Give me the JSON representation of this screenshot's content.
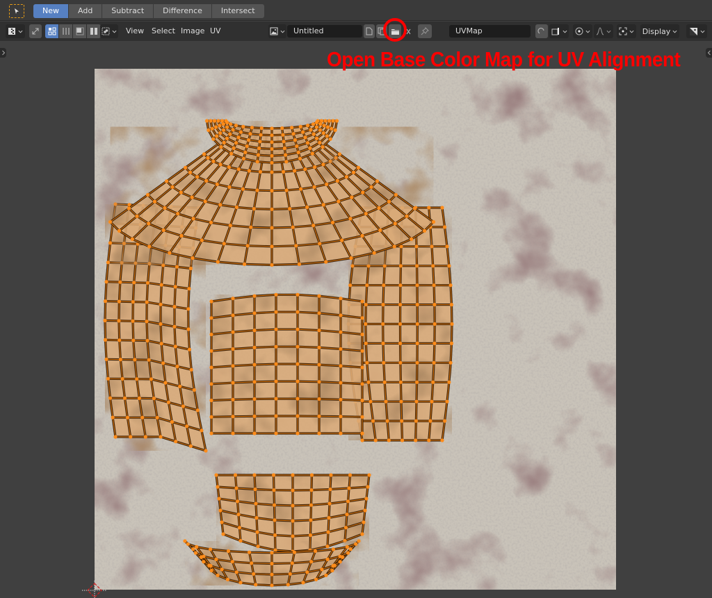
{
  "tool_header": {
    "active_tool": "select-box",
    "modes": [
      {
        "label": "New",
        "active": true
      },
      {
        "label": "Add",
        "active": false
      },
      {
        "label": "Subtract",
        "active": false
      },
      {
        "label": "Difference",
        "active": false
      },
      {
        "label": "Intersect",
        "active": false
      }
    ]
  },
  "editor_header": {
    "editor_type_icon": "uv-editor-icon",
    "menus": [
      "View",
      "Select",
      "Image",
      "UV"
    ],
    "image_name": "Untitled",
    "uv_map": "UVMap",
    "display_label": "Display"
  },
  "annotation": {
    "text": "Open Base Color Map for UV Alignment",
    "color": "#ff0000"
  },
  "colors": {
    "accent": "#5680c2",
    "vertex": "#ff8c1a",
    "edge": "#3a2008",
    "face_fill": "#d9aa78",
    "texture_base": "#c9c2b8",
    "texture_stain": "#5a3c3c"
  }
}
